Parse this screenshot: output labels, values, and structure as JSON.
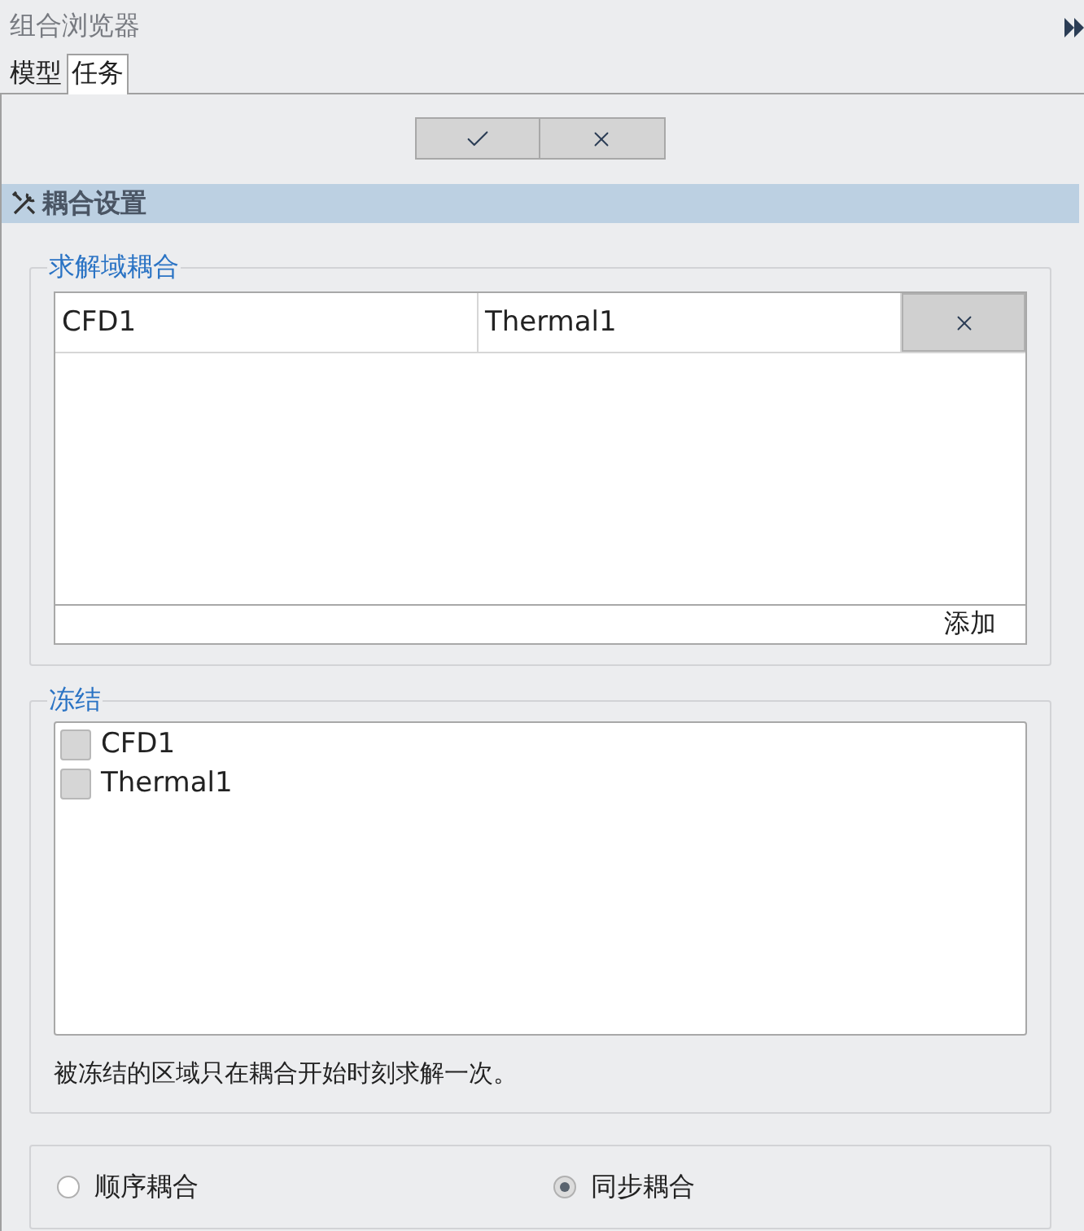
{
  "window": {
    "title": "组合浏览器"
  },
  "tabs": [
    {
      "label": "模型",
      "selected": false
    },
    {
      "label": "任务",
      "selected": true
    }
  ],
  "section": {
    "title": "耦合设置"
  },
  "solver_coupling": {
    "legend": "求解域耦合",
    "rows": [
      {
        "cells": [
          "CFD1",
          "Thermal1"
        ]
      }
    ],
    "add_label": "添加"
  },
  "freeze": {
    "legend": "冻结",
    "items": [
      {
        "label": "CFD1",
        "checked": false
      },
      {
        "label": "Thermal1",
        "checked": false
      }
    ],
    "note": "被冻结的区域只在耦合开始时刻求解一次。"
  },
  "mode": [
    {
      "label": "顺序耦合",
      "selected": false
    },
    {
      "label": "同步耦合",
      "selected": true
    }
  ]
}
